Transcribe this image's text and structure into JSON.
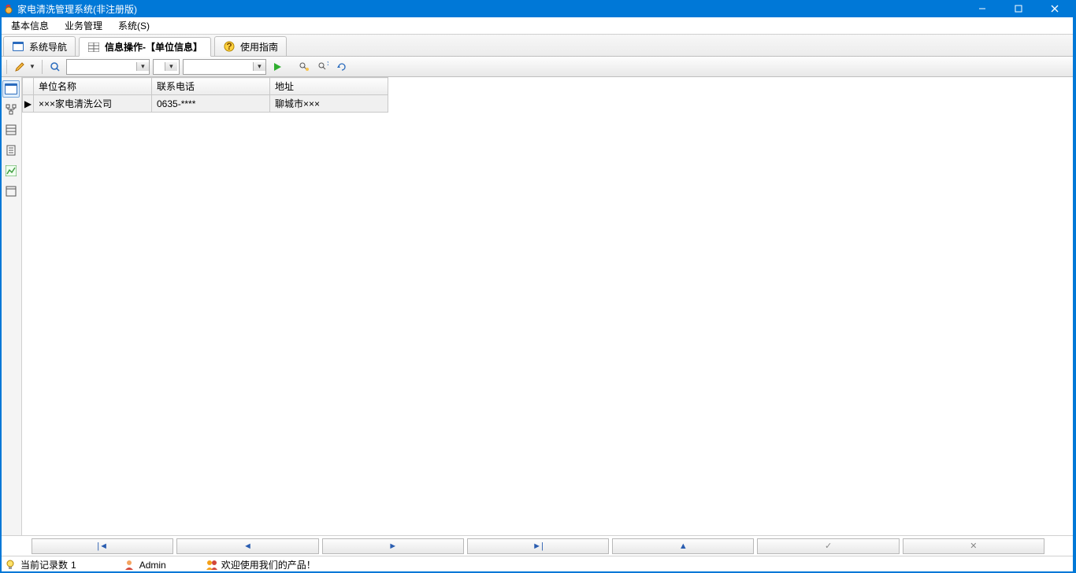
{
  "window": {
    "title": "家电清洗管理系统(非注册版)"
  },
  "menubar": {
    "items": [
      "基本信息",
      "业务管理",
      "系统(S)"
    ]
  },
  "tabs": [
    {
      "label": "系统导航",
      "icon": "window-icon"
    },
    {
      "label": "信息操作-【单位信息】",
      "icon": "table-icon",
      "active": true
    },
    {
      "label": "使用指南",
      "icon": "help-icon"
    }
  ],
  "toolbar": {
    "combo1_value": "",
    "combo2_value": "",
    "combo3_value": ""
  },
  "table": {
    "columns": [
      "单位名称",
      "联系电话",
      "地址"
    ],
    "rows": [
      {
        "name": "×××家电清洗公司",
        "phone": "0635-****",
        "address": "聊城市×××"
      }
    ]
  },
  "status": {
    "record_label": "当前记录数",
    "record_count": "1",
    "user": "Admin",
    "welcome": "欢迎使用我们的产品！"
  }
}
